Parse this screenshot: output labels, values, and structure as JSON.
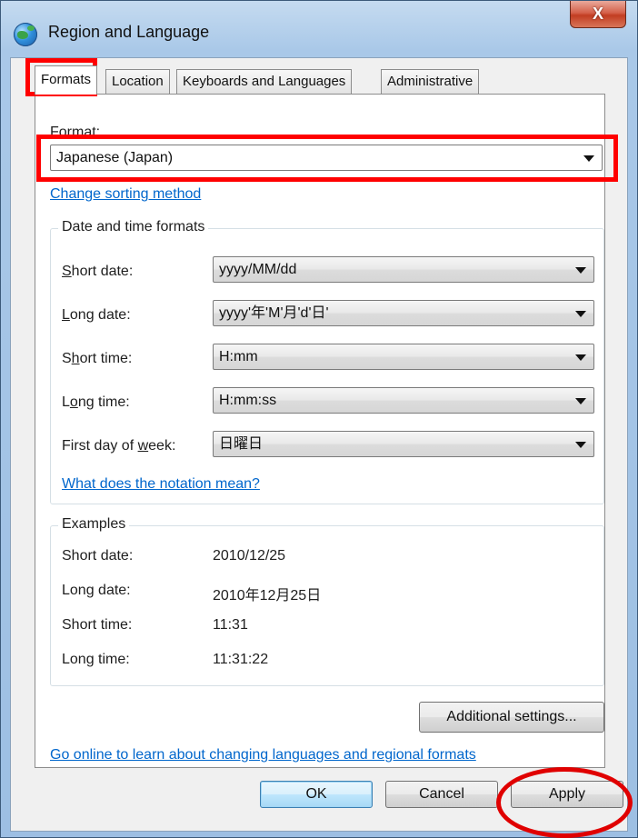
{
  "window": {
    "title": "Region and Language",
    "close_label": "X"
  },
  "tabs": [
    {
      "label": "Formats",
      "active": true
    },
    {
      "label": "Location",
      "active": false
    },
    {
      "label": "Keyboards and Languages",
      "active": false
    },
    {
      "label": "Administrative",
      "active": false
    }
  ],
  "formats": {
    "format_label": "Format:",
    "format_value": "Japanese (Japan)",
    "change_sorting_link": "Change sorting method"
  },
  "date_time_formats": {
    "group_title": "Date and time formats",
    "rows": [
      {
        "label": "Short date:",
        "value": "yyyy/MM/dd"
      },
      {
        "label": "Long date:",
        "value": "yyyy'年'M'月'd'日'"
      },
      {
        "label": "Short time:",
        "value": "H:mm"
      },
      {
        "label": "Long time:",
        "value": "H:mm:ss"
      },
      {
        "label": "First day of week:",
        "value": "日曜日"
      }
    ],
    "notation_link": "What does the notation mean?"
  },
  "examples": {
    "group_title": "Examples",
    "rows": [
      {
        "label": "Short date:",
        "value": "2010/12/25"
      },
      {
        "label": "Long date:",
        "value": "2010年12月25日"
      },
      {
        "label": "Short time:",
        "value": "11:31"
      },
      {
        "label": "Long time:",
        "value": "11:31:22"
      }
    ]
  },
  "additional_settings_label": "Additional settings...",
  "online_link": "Go online to learn about changing languages and regional formats",
  "footer": {
    "ok_label": "OK",
    "cancel_label": "Cancel",
    "apply_label": "Apply"
  },
  "colors": {
    "highlight": "#ff0000",
    "link": "#0066cc"
  }
}
